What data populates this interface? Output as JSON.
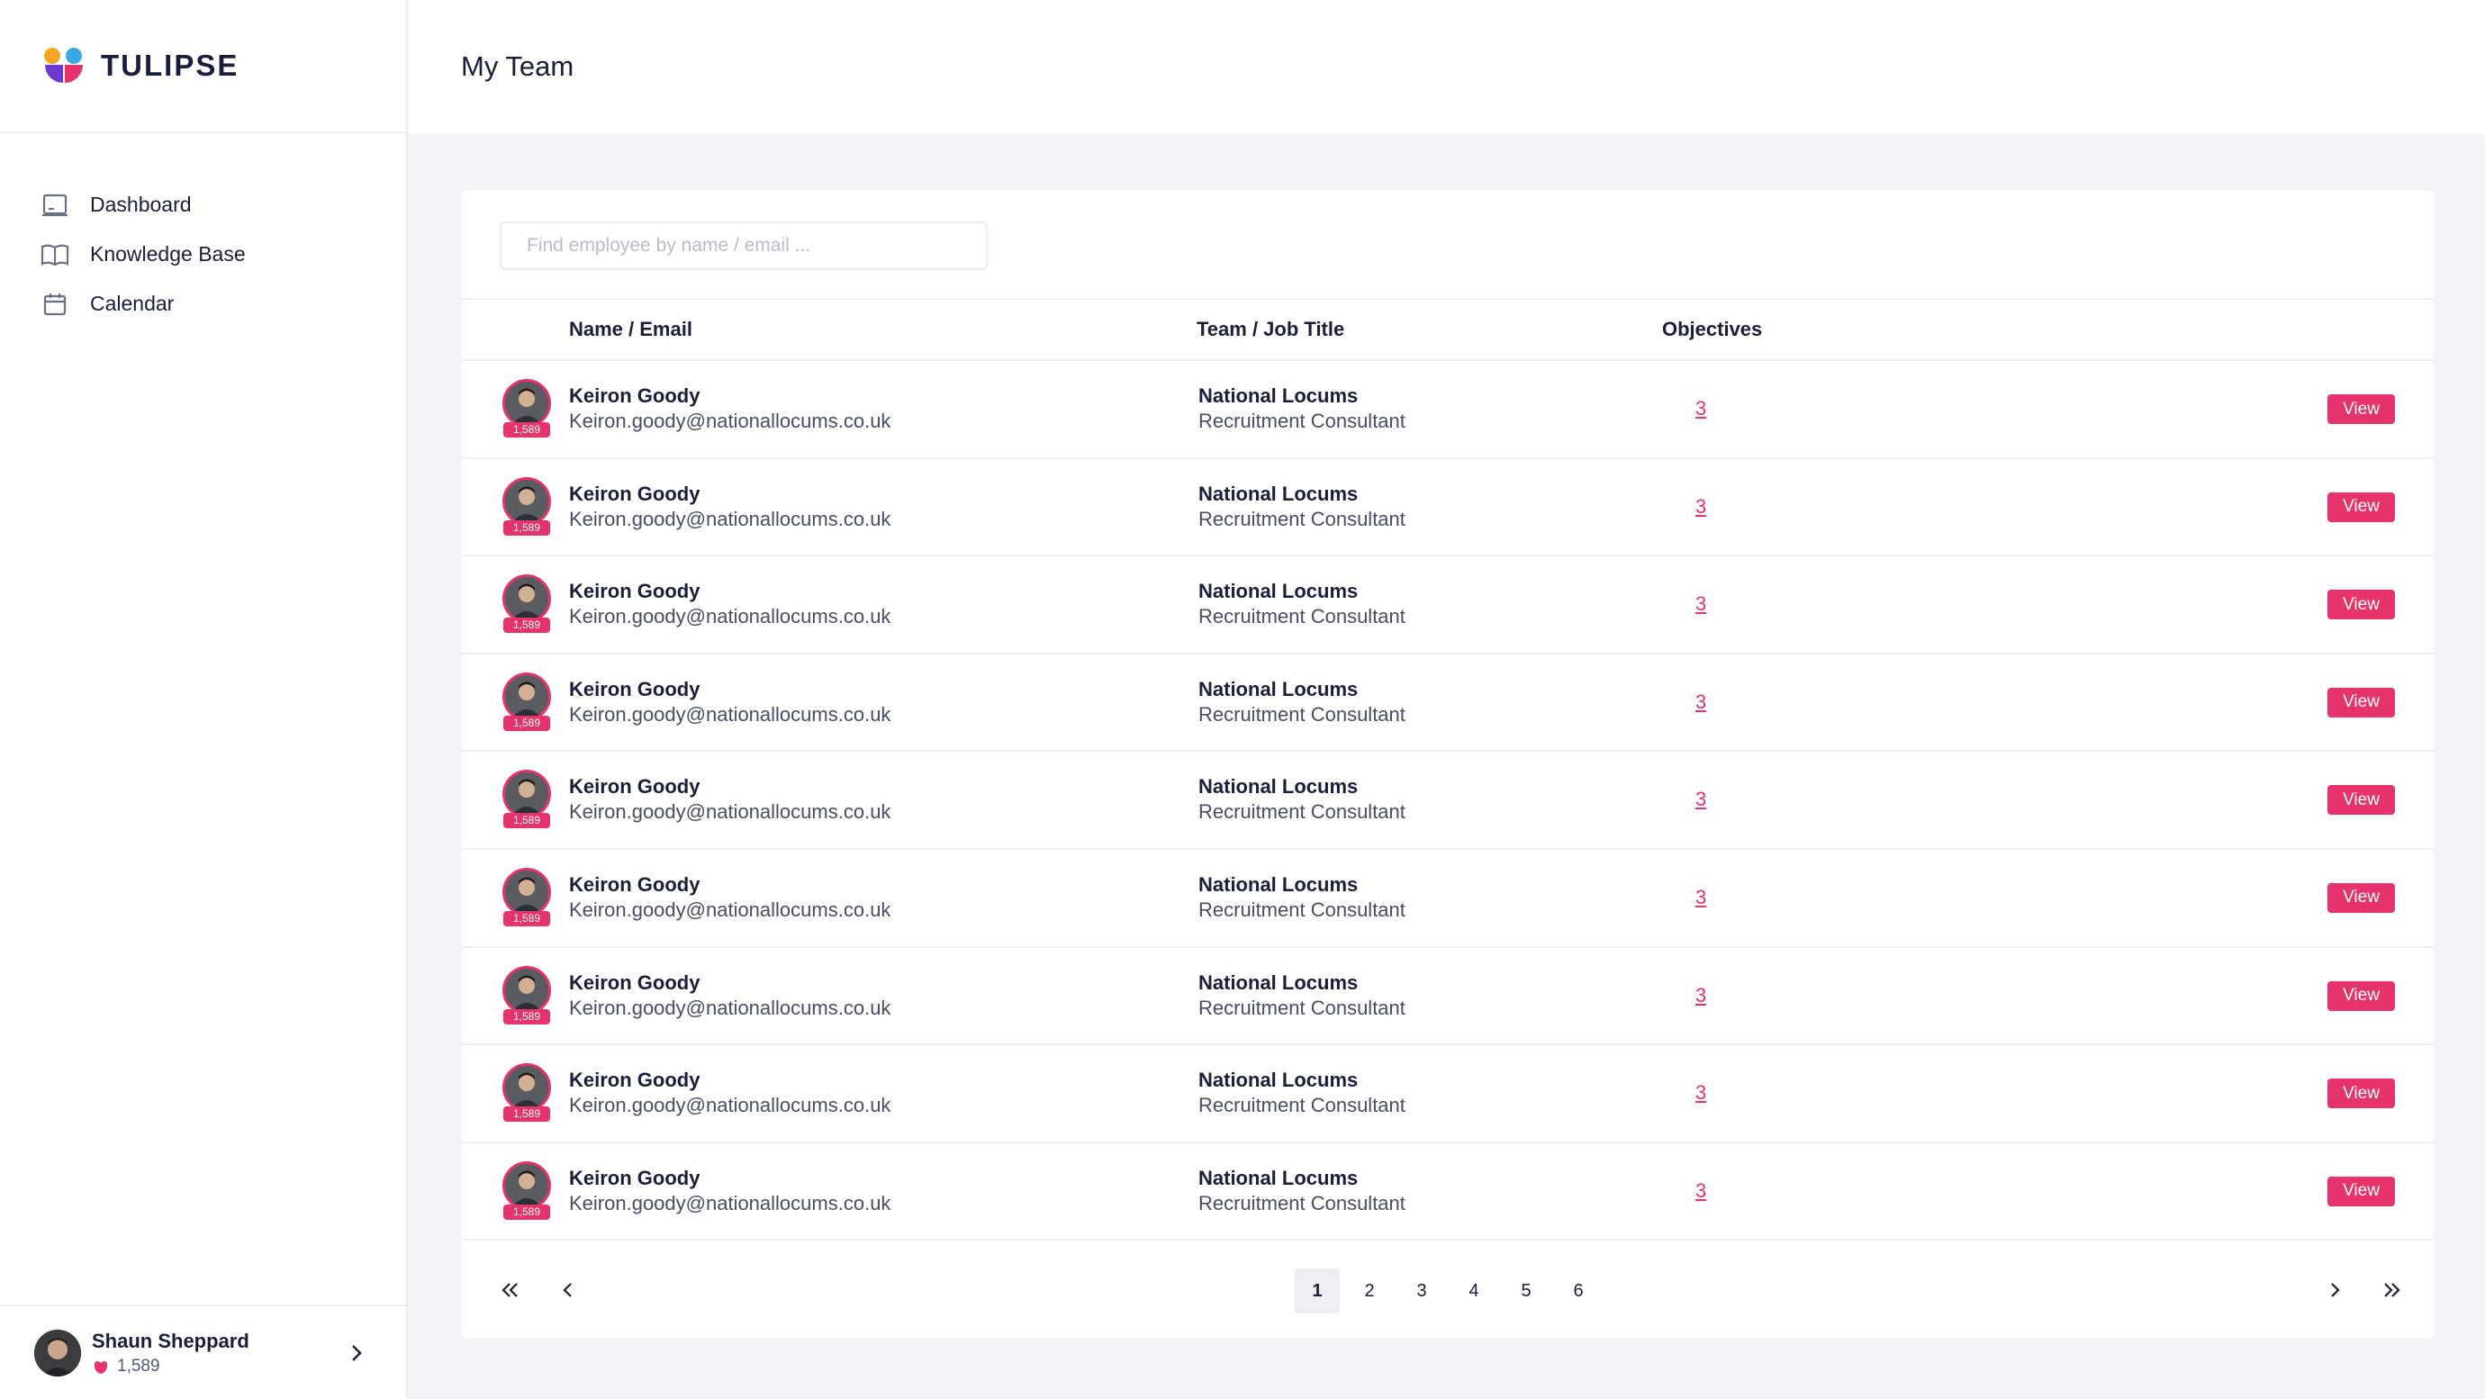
{
  "brand": {
    "name": "TULIPSE"
  },
  "sidebar": {
    "items": [
      {
        "label": "Dashboard",
        "icon": "dashboard-icon"
      },
      {
        "label": "Knowledge Base",
        "icon": "book-icon"
      },
      {
        "label": "Calendar",
        "icon": "calendar-icon"
      }
    ]
  },
  "profile": {
    "name": "Shaun Sheppard",
    "points": "1,589"
  },
  "header": {
    "title": "My Team"
  },
  "search": {
    "placeholder": "Find employee by name / email ..."
  },
  "table": {
    "columns": {
      "name": "Name / Email",
      "team": "Team / Job Title",
      "objectives": "Objectives"
    },
    "rows": [
      {
        "name": "Keiron Goody",
        "email": "Keiron.goody@nationallocums.co.uk",
        "team": "National Locums",
        "job": "Recruitment Consultant",
        "objectives": "3",
        "badge": "1,589",
        "action": "View"
      },
      {
        "name": "Keiron Goody",
        "email": "Keiron.goody@nationallocums.co.uk",
        "team": "National Locums",
        "job": "Recruitment Consultant",
        "objectives": "3",
        "badge": "1,589",
        "action": "View"
      },
      {
        "name": "Keiron Goody",
        "email": "Keiron.goody@nationallocums.co.uk",
        "team": "National Locums",
        "job": "Recruitment Consultant",
        "objectives": "3",
        "badge": "1,589",
        "action": "View"
      },
      {
        "name": "Keiron Goody",
        "email": "Keiron.goody@nationallocums.co.uk",
        "team": "National Locums",
        "job": "Recruitment Consultant",
        "objectives": "3",
        "badge": "1,589",
        "action": "View"
      },
      {
        "name": "Keiron Goody",
        "email": "Keiron.goody@nationallocums.co.uk",
        "team": "National Locums",
        "job": "Recruitment Consultant",
        "objectives": "3",
        "badge": "1,589",
        "action": "View"
      },
      {
        "name": "Keiron Goody",
        "email": "Keiron.goody@nationallocums.co.uk",
        "team": "National Locums",
        "job": "Recruitment Consultant",
        "objectives": "3",
        "badge": "1,589",
        "action": "View"
      },
      {
        "name": "Keiron Goody",
        "email": "Keiron.goody@nationallocums.co.uk",
        "team": "National Locums",
        "job": "Recruitment Consultant",
        "objectives": "3",
        "badge": "1,589",
        "action": "View"
      },
      {
        "name": "Keiron Goody",
        "email": "Keiron.goody@nationallocums.co.uk",
        "team": "National Locums",
        "job": "Recruitment Consultant",
        "objectives": "3",
        "badge": "1,589",
        "action": "View"
      },
      {
        "name": "Keiron Goody",
        "email": "Keiron.goody@nationallocums.co.uk",
        "team": "National Locums",
        "job": "Recruitment Consultant",
        "objectives": "3",
        "badge": "1,589",
        "action": "View"
      }
    ]
  },
  "pagination": {
    "pages": [
      "1",
      "2",
      "3",
      "4",
      "5",
      "6"
    ],
    "current": "1"
  },
  "colors": {
    "accent": "#e6336b",
    "text": "#1b1d3a",
    "background": "#f4f4f7"
  }
}
